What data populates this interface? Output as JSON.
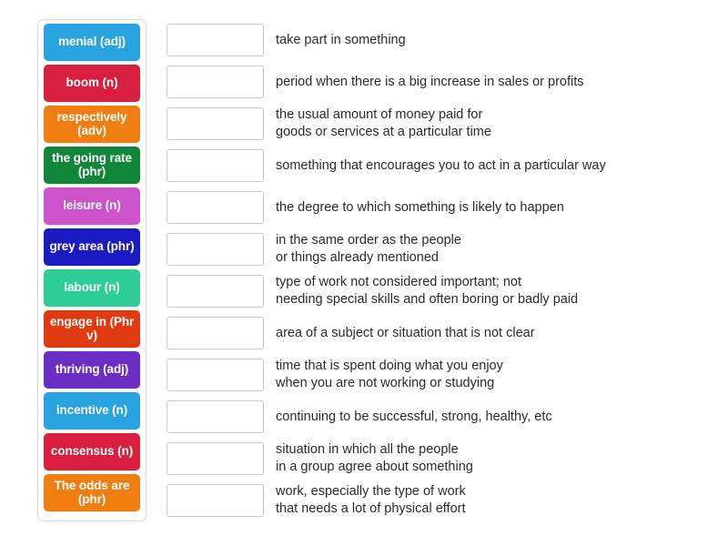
{
  "exercise": {
    "type": "match-up",
    "tile_text_color": "#ffffff",
    "slot_border_color": "#c8c8c8",
    "container_border_color": "#dcdcdc",
    "definition_text_color": "#2b2b2b",
    "slot_placeholder": ""
  },
  "tiles": [
    {
      "label": "menial (adj)",
      "color": "#29a3e0"
    },
    {
      "label": "boom (n)",
      "color": "#d91f40"
    },
    {
      "label": "respectively\n(adv)",
      "color": "#f07d10"
    },
    {
      "label": "the going\nrate (phr)",
      "color": "#11853a"
    },
    {
      "label": "leisure (n)",
      "color": "#cc53cc"
    },
    {
      "label": "grey area\n(phr)",
      "color": "#1b1bc4"
    },
    {
      "label": "labour (n)",
      "color": "#2ecc96"
    },
    {
      "label": "engage\nin (Phr v)",
      "color": "#e03a10"
    },
    {
      "label": "thriving (adj)",
      "color": "#6a2ec4"
    },
    {
      "label": "incentive (n)",
      "color": "#29a3e0"
    },
    {
      "label": "consensus\n(n)",
      "color": "#d91f40"
    },
    {
      "label": "The odds\nare (phr)",
      "color": "#f07d10"
    }
  ],
  "rows": [
    {
      "answer": "",
      "definition": "take part in something"
    },
    {
      "answer": "",
      "definition": "period when there is a big increase in sales or profits"
    },
    {
      "answer": "",
      "definition": "the usual amount of money paid for\ngoods or services at a particular time"
    },
    {
      "answer": "",
      "definition": "something that encourages you to act in a particular way"
    },
    {
      "answer": "",
      "definition": "the degree to which something is likely to happen"
    },
    {
      "answer": "",
      "definition": "in the same order as the people\nor things already mentioned"
    },
    {
      "answer": "",
      "definition": "type of work not considered important; not\nneeding special skills and often boring or badly paid"
    },
    {
      "answer": "",
      "definition": "area of a subject or situation that is not clear"
    },
    {
      "answer": "",
      "definition": "time that is spent doing what you enjoy\nwhen you are not working or studying"
    },
    {
      "answer": "",
      "definition": "continuing to be successful, strong, healthy, etc"
    },
    {
      "answer": "",
      "definition": "situation in which all the people\nin a group agree about something"
    },
    {
      "answer": "",
      "definition": "work, especially the type of work\nthat needs a lot of physical effort"
    }
  ]
}
